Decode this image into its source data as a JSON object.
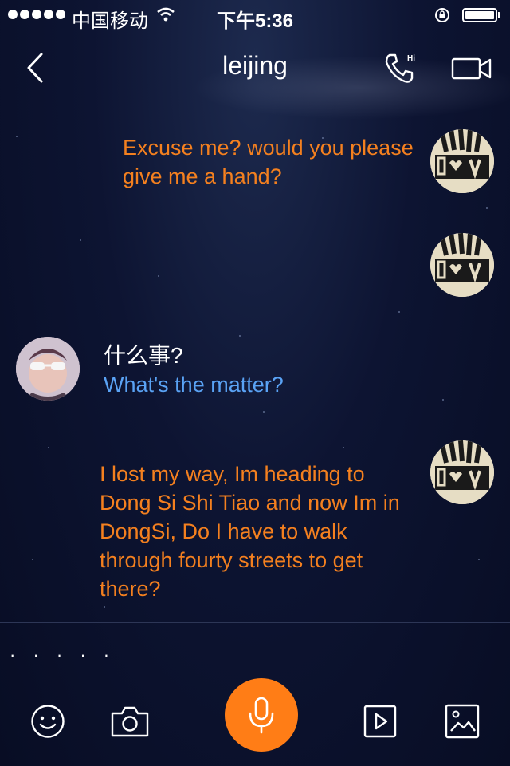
{
  "status_bar": {
    "carrier": "中国移动",
    "time": "下午5:36",
    "battery_level": 1.0
  },
  "header": {
    "title": "leijing",
    "call_icon_label": "Hi"
  },
  "messages": [
    {
      "sender": "me",
      "text": "Excuse me? would you please give me a hand?"
    },
    {
      "sender": "me",
      "text": ""
    },
    {
      "sender": "other",
      "text": "什么事?",
      "translation": "What's the matter?"
    },
    {
      "sender": "me",
      "text": "I lost my way, Im heading to Dong Si Shi Tiao and now Im in DongSi, Do I have to walk through fourty streets to get there?"
    }
  ],
  "composer": {
    "typing_indicator": "· · · · ·"
  },
  "toolbar": {
    "icons": [
      "smile-icon",
      "camera-icon",
      "microphone-icon",
      "play-icon",
      "image-icon"
    ]
  },
  "colors": {
    "outgoing_text": "#f4801f",
    "translation_text": "#5aa3f5",
    "mic_button": "#ff7d16",
    "background": "#0d1432"
  }
}
